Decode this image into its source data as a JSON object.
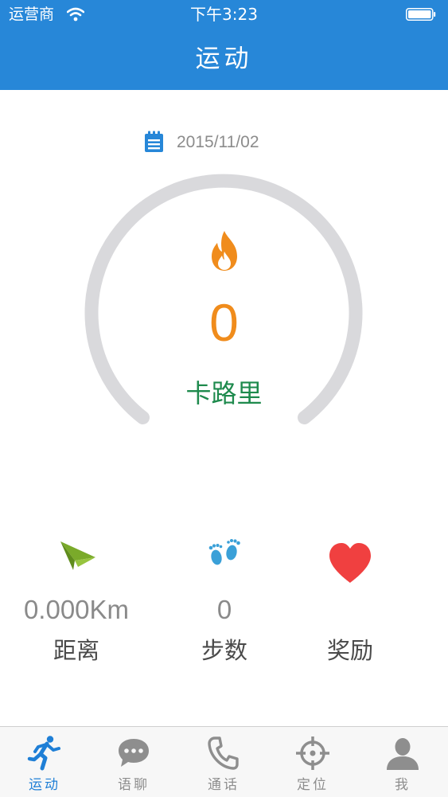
{
  "status_bar": {
    "carrier": "运营商",
    "time": "下午3:23"
  },
  "nav": {
    "title": "运动"
  },
  "date": "2015/11/02",
  "calories": {
    "value": "0",
    "unit": "卡路里",
    "icon": "flame-icon"
  },
  "stats": [
    {
      "icon": "paper-plane-icon",
      "value": "0.000Km",
      "label": "距离"
    },
    {
      "icon": "footprints-icon",
      "value": "0",
      "label": "步数"
    },
    {
      "icon": "heart-icon",
      "value": "",
      "label": "奖励"
    }
  ],
  "tabs": [
    {
      "label": "运动",
      "icon": "running-icon",
      "active": true
    },
    {
      "label": "语聊",
      "icon": "chat-bubble-icon",
      "active": false
    },
    {
      "label": "通话",
      "icon": "phone-icon",
      "active": false
    },
    {
      "label": "定位",
      "icon": "crosshair-icon",
      "active": false
    },
    {
      "label": "我",
      "icon": "person-icon",
      "active": false
    }
  ],
  "colors": {
    "accent": "#2787d8",
    "calorie": "#f08c1c",
    "calorie_unit": "#1e8a4d",
    "gauge_track": "#d9d9dc",
    "heart": "#f04040",
    "plane": "#7aaa2a",
    "footprints": "#3aa0d8"
  }
}
